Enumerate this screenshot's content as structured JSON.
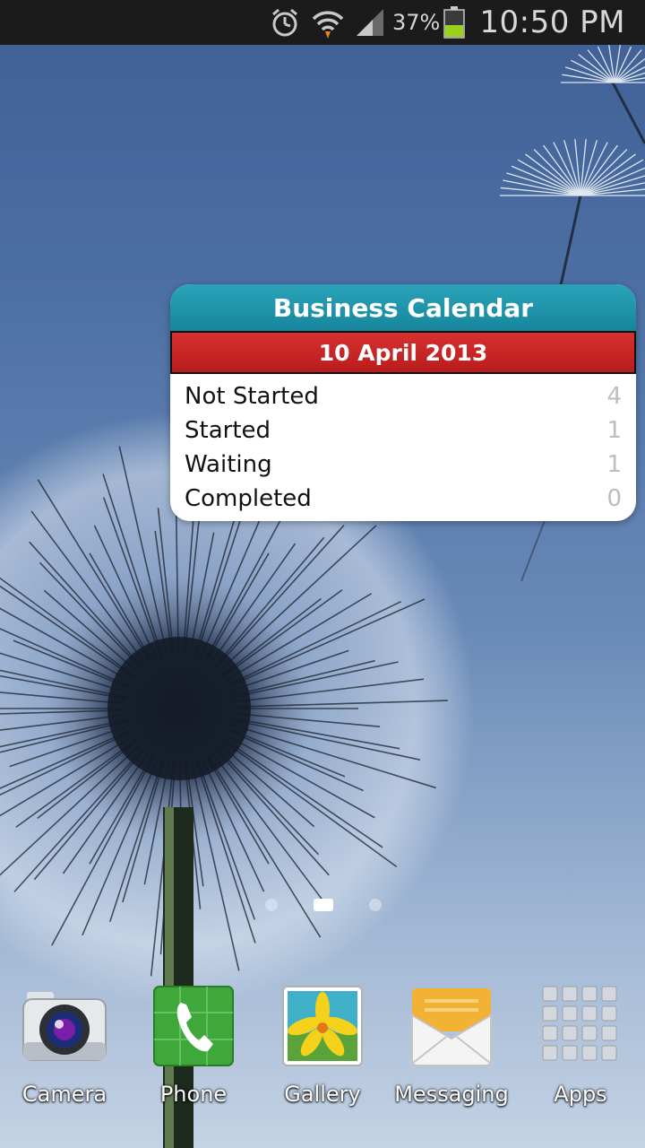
{
  "status_bar": {
    "battery_percent": "37%",
    "time": "10:50 PM",
    "icons": [
      "alarm-icon",
      "wifi-icon",
      "signal-icon",
      "battery-icon"
    ]
  },
  "widget": {
    "title": "Business Calendar",
    "date": "10 April 2013",
    "statuses": [
      {
        "label": "Not Started",
        "count": "4"
      },
      {
        "label": "Started",
        "count": "1"
      },
      {
        "label": "Waiting",
        "count": "1"
      },
      {
        "label": "Completed",
        "count": "0"
      }
    ],
    "colors": {
      "header": "#1a8fa5",
      "date_bar": "#c82424"
    }
  },
  "home_pages": {
    "count": 3,
    "active_index": 1
  },
  "dock": {
    "apps": [
      {
        "label": "Camera",
        "icon": "camera-icon"
      },
      {
        "label": "Phone",
        "icon": "phone-icon"
      },
      {
        "label": "Gallery",
        "icon": "gallery-icon"
      },
      {
        "label": "Messaging",
        "icon": "messaging-icon"
      },
      {
        "label": "Apps",
        "icon": "apps-grid-icon"
      }
    ]
  }
}
